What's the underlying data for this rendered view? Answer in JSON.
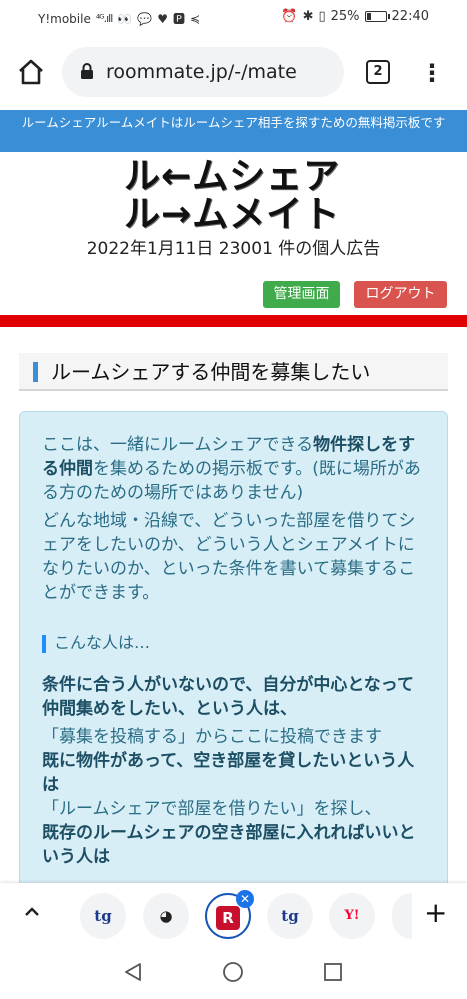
{
  "status_bar": {
    "carrier": "Y!mobile",
    "signal": "⁴ᴳ.ıll",
    "battery_pct": "25%",
    "battery_level": 0.25,
    "time": "22:40"
  },
  "browser": {
    "url": "roommate.jp/-/mate",
    "tab_count": "2",
    "menu_glyph": "⋮"
  },
  "page": {
    "notice": "ルームシェアルームメイトはルームシェア相手を探すための無料掲示板です",
    "logo_line1": "ル←ムシェア",
    "logo_line2": "ル→ムメイト",
    "tagline": "2022年1月11日 23001 件の個人広告",
    "admin_button": "管理画面",
    "logout_button": "ログアウト",
    "section_title": "ルームシェアする仲間を募集したい",
    "intro_1a": "ここは、一緒にルームシェアできる",
    "intro_1b": "物件探しをする仲間",
    "intro_1c": "を集めるための掲示板です。(既に場所がある方のための場所ではありません)",
    "intro_2": "どんな地域・沿線で、どういった部屋を借りてシェアをしたいのか、どういう人とシェアメイトになりたいのか、といった条件を書いて募集することができます。",
    "subheading": "こんな人は…",
    "case_1_title": "条件に合う人がいないので、自分が中心となって仲間集めをしたい、という人は、",
    "case_1_action": "「募集を投稿する」からここに投稿できます",
    "case_2_title": "既に物件があって、空き部屋を貸したいという人は",
    "case_2_action": "「ルームシェアで部屋を借りたい」を探し、",
    "case_3_title": "既存のルームシェアの空き部屋に入れればいいという人は"
  },
  "tab_strip": {
    "tabs": [
      {
        "label": "tg"
      },
      {
        "label": "◕"
      },
      {
        "label": "R"
      },
      {
        "label": "tg"
      },
      {
        "label": "Y!"
      }
    ],
    "close_glyph": "✕",
    "new_tab_glyph": "+"
  },
  "colors": {
    "notice_bg": "#3a8ed6",
    "admin_green": "#3fab4a",
    "logout_red": "#d9534f",
    "rule_red": "#e00000",
    "info_bg": "#d8eef7"
  }
}
